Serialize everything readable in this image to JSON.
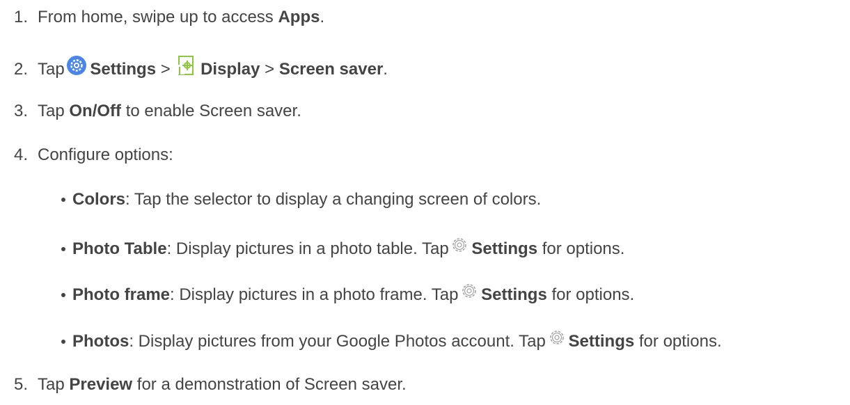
{
  "steps": [
    {
      "num": "1.",
      "text1": "From home, swipe up to access ",
      "bold1": "Apps",
      "text2": "."
    },
    {
      "num": "2.",
      "text1": "Tap ",
      "bold1": "Settings",
      "sep1": " > ",
      "bold2": "Display",
      "sep2": " > ",
      "bold3": "Screen saver",
      "text2": "."
    },
    {
      "num": "3.",
      "text1": "Tap ",
      "bold1": "On/Off",
      "text2": " to enable Screen saver."
    },
    {
      "num": "4.",
      "text1": "Configure options:"
    },
    {
      "num": "5.",
      "text1": "Tap ",
      "bold1": "Preview",
      "text2": " for a demonstration of Screen saver."
    }
  ],
  "options": [
    {
      "bold": "Colors",
      "text": ": Tap the selector to display a changing screen of colors."
    },
    {
      "bold": "Photo Table",
      "text": ": Display pictures in a photo table. Tap ",
      "bold2": "Settings",
      "text2": " for options."
    },
    {
      "bold": "Photo frame",
      "text": ": Display pictures in a photo frame. Tap ",
      "bold2": "Settings",
      "text2": " for options."
    },
    {
      "bold": "Photos",
      "text": ": Display pictures from your Google Photos account. Tap ",
      "bold2": "Settings",
      "text2": " for options."
    }
  ],
  "icons": {
    "settings_app": "settings-app-icon",
    "display": "display-icon",
    "gear": "gear-outline-icon"
  },
  "colors": {
    "text": "#444444",
    "settings_icon_blue": "#4a86e8",
    "display_icon_green": "#8dc63f"
  }
}
